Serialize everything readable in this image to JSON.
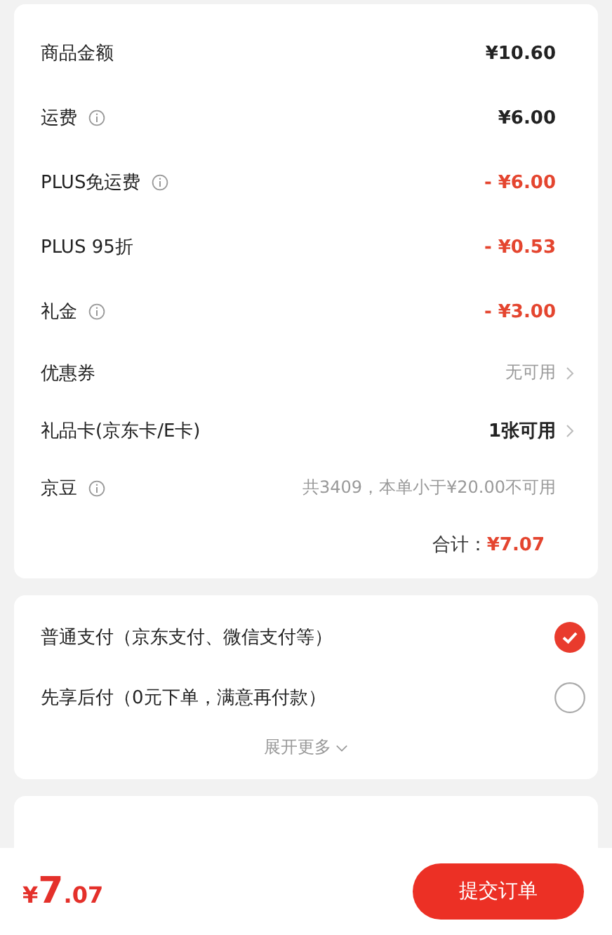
{
  "price_rows": [
    {
      "label": "商品金额",
      "info": false,
      "value": "¥10.60",
      "kind": "plain",
      "arrow": false
    },
    {
      "label": "运费",
      "info": true,
      "value": "¥6.00",
      "kind": "plain",
      "arrow": false
    },
    {
      "label": "PLUS免运费",
      "info": true,
      "value": "- ¥6.00",
      "kind": "discount",
      "arrow": false
    },
    {
      "label": "PLUS 95折",
      "info": false,
      "value": "- ¥0.53",
      "kind": "discount",
      "arrow": false
    },
    {
      "label": "礼金",
      "info": true,
      "value": "- ¥3.00",
      "kind": "discount",
      "arrow": false
    },
    {
      "label": "优惠券",
      "info": false,
      "value": "无可用",
      "kind": "muted",
      "arrow": true
    },
    {
      "label": "礼品卡(京东卡/E卡)",
      "info": false,
      "value": "1张可用",
      "kind": "plain",
      "arrow": true
    },
    {
      "label": "京豆",
      "info": true,
      "value": "共3409，本单小于¥20.00不可用",
      "kind": "muted",
      "arrow": false
    }
  ],
  "total": {
    "label": "合计：",
    "value": "¥7.07"
  },
  "payment_options": [
    {
      "label": "普通支付（京东支付、微信支付等）",
      "selected": true
    },
    {
      "label": "先享后付（0元下单，满意再付款）",
      "selected": false
    }
  ],
  "expand": "展开更多",
  "bottom_bar": {
    "currency": "¥",
    "integer": "7",
    "decimal": ".07",
    "submit": "提交订单"
  }
}
